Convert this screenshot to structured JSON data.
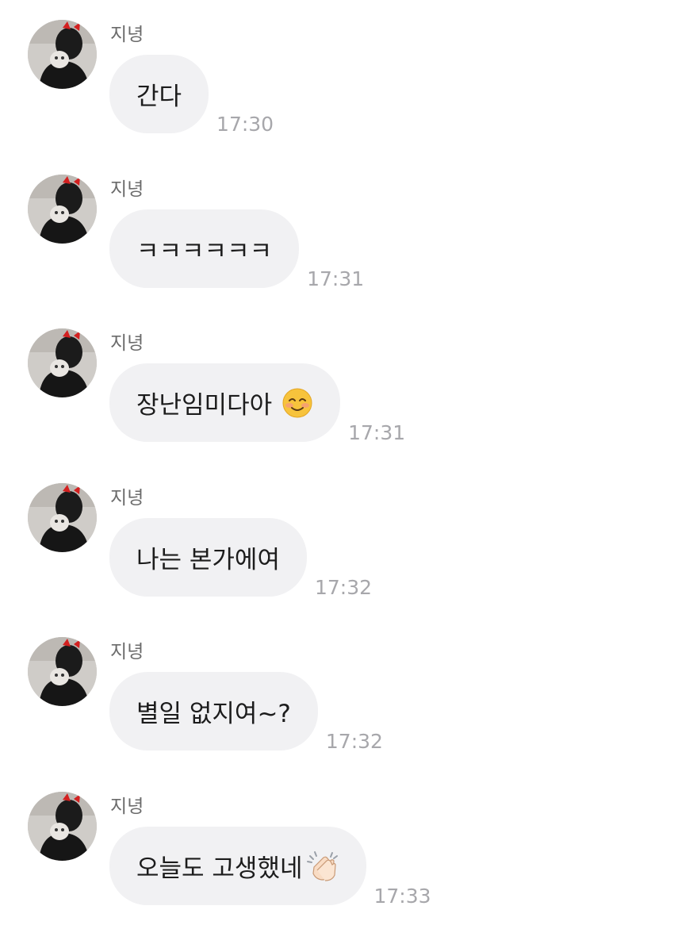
{
  "conversation": {
    "messages": [
      {
        "sender": "지녕",
        "text": "간다",
        "time": "17:30",
        "emoji": ""
      },
      {
        "sender": "지녕",
        "text": "ㅋㅋㅋㅋㅋㅋ",
        "time": "17:31",
        "emoji": ""
      },
      {
        "sender": "지녕",
        "text": "장난임미다아",
        "time": "17:31",
        "emoji": "smiling-blush-icon"
      },
      {
        "sender": "지녕",
        "text": "나는 본가에여",
        "time": "17:32",
        "emoji": ""
      },
      {
        "sender": "지녕",
        "text": "별일 없지여~?",
        "time": "17:32",
        "emoji": ""
      },
      {
        "sender": "지녕",
        "text": "오늘도 고생했네",
        "time": "17:33",
        "emoji": "clapping-hands-icon"
      }
    ]
  },
  "colors": {
    "bubble_background": "#f1f1f3",
    "message_text": "#1c1c1c",
    "sender_text": "#6b6b6b",
    "timestamp_text": "#a7a7ab"
  }
}
